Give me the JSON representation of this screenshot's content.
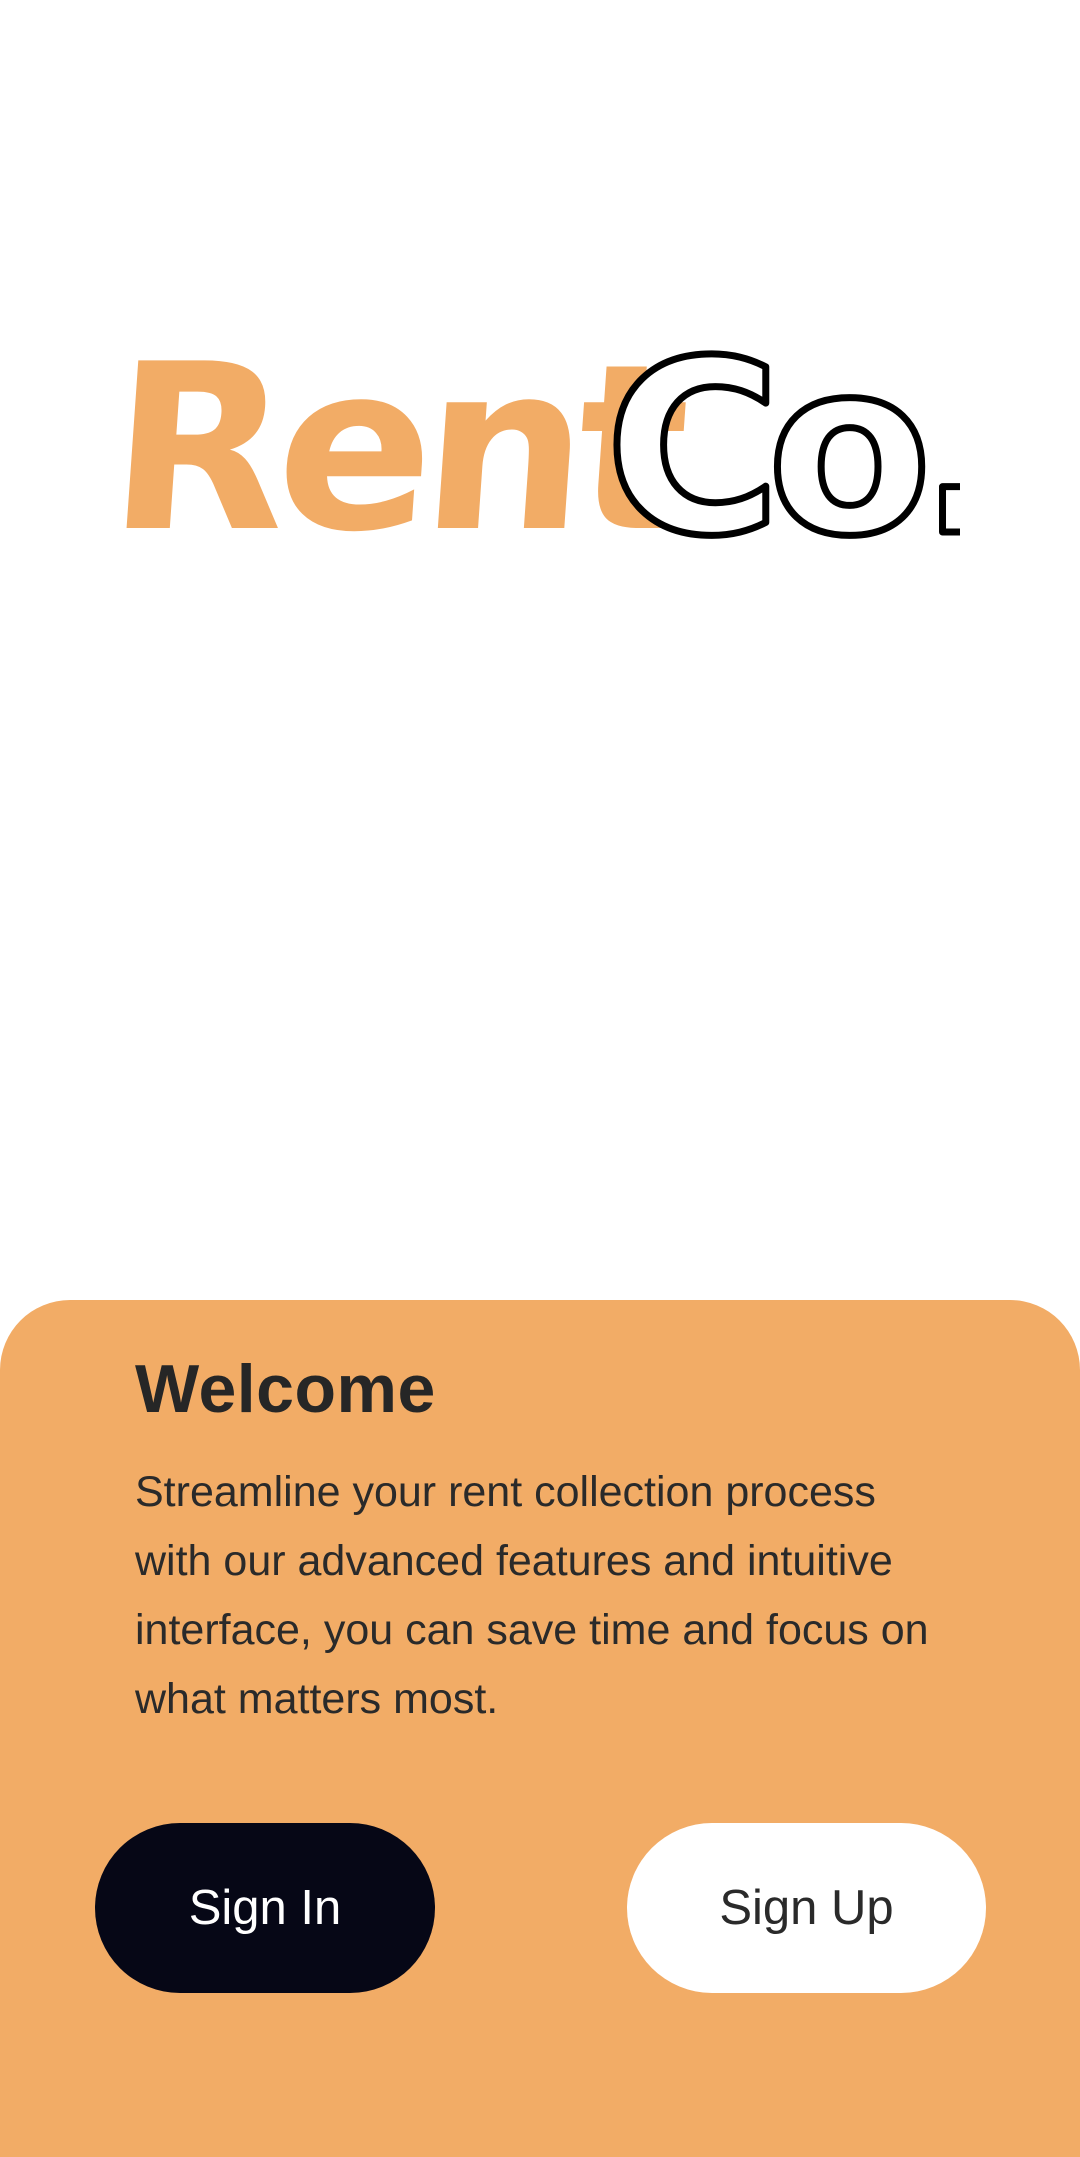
{
  "logo": {
    "brand_name": "RentCo.",
    "part_rent": "Rent",
    "part_co": "Co.",
    "rent_color": "#f2ac66",
    "co_stroke_color": "#000000"
  },
  "welcome": {
    "title": "Welcome",
    "description": "Streamline your rent collection process with our advanced features and intuitive interface, you can save time and focus on what matters most."
  },
  "actions": {
    "sign_in_label": "Sign In",
    "sign_up_label": "Sign Up"
  },
  "colors": {
    "accent": "#f2ac66",
    "primary_button": "#060716",
    "secondary_button": "#ffffff",
    "text_dark": "#262626"
  }
}
